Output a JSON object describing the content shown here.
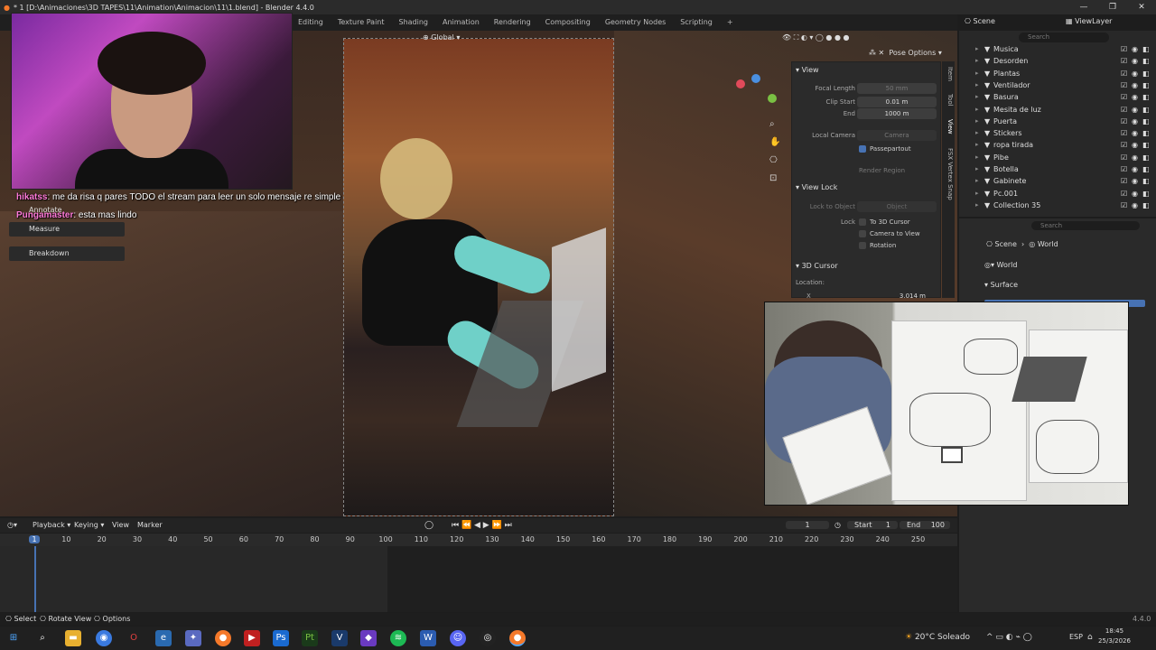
{
  "title_bar": {
    "title": "* 1 [D:\\Animaciones\\3D TAPES\\11\\Animation\\Animacion\\11\\1.blend] - Blender 4.4.0",
    "minimize": "—",
    "maximize": "❐",
    "close": "✕"
  },
  "workspace_tabs": [
    "Editing",
    "Texture Paint",
    "Shading",
    "Animation",
    "Rendering",
    "Compositing",
    "Geometry Nodes",
    "Scripting",
    "+"
  ],
  "viewport_header": {
    "orientation": "Global",
    "pose_options": "Pose Options"
  },
  "chat": [
    {
      "user": "hikatss",
      "message": "me da risa q pares TODO el stream para leer un solo mensaje re simple"
    },
    {
      "user": "Pungamaster",
      "message": "esta mas lindo"
    }
  ],
  "tool_popups": [
    "Annotate",
    "Measure",
    "Breakdown"
  ],
  "npanel": {
    "tabs": [
      "Item",
      "Tool",
      "View",
      "FSX Vertex Snap"
    ],
    "view_header": "View",
    "focal_length_label": "Focal Length",
    "focal_length_value": "50 mm",
    "clip_start_label": "Clip Start",
    "clip_start_value": "0.01 m",
    "end_label": "End",
    "end_value": "1000 m",
    "local_camera_label": "Local Camera",
    "local_camera_value": "Camera",
    "passepartout_label": "Passepartout",
    "render_region_label": "Render Region",
    "view_lock_header": "View Lock",
    "lock_to_object_label": "Lock to Object",
    "lock_to_object_value": "Object",
    "lock_label": "Lock",
    "to_3d_cursor": "To 3D Cursor",
    "camera_to_view": "Camera to View",
    "rotation": "Rotation",
    "cursor_header": "3D Cursor",
    "location_label": "Location:",
    "x_label": "X",
    "x_value": "3.014 m"
  },
  "outliner": {
    "scene": "Scene",
    "view_layer": "ViewLayer",
    "search_placeholder": "Search",
    "items": [
      "Musica",
      "Desorden",
      "Plantas",
      "Ventilador",
      "Basura",
      "Mesita de luz",
      "Puerta",
      "Stickers",
      "ropa tirada",
      "Pibe",
      "Botella",
      "Gabinete",
      "Pc.001",
      "Collection 35"
    ]
  },
  "properties": {
    "breadcrumb_scene": "Scene",
    "breadcrumb_world": "World",
    "world_name": "World",
    "surface": "Surface",
    "search_placeholder": "Search"
  },
  "timeline": {
    "menus": [
      "Playback",
      "Keying",
      "View",
      "Marker"
    ],
    "current_frame": "1",
    "start_label": "Start",
    "start_value": "1",
    "end_label": "End",
    "end_value": "100",
    "ticks": [
      "1",
      "10",
      "20",
      "30",
      "40",
      "50",
      "60",
      "70",
      "80",
      "90",
      "100",
      "110",
      "120",
      "130",
      "140",
      "150",
      "160",
      "170",
      "180",
      "190",
      "200",
      "210",
      "220",
      "230",
      "240",
      "250"
    ]
  },
  "status_bar": {
    "select": "Select",
    "rotate_view": "Rotate View",
    "options": "Options",
    "version": "4.4.0"
  },
  "taskbar": {
    "weather": "20°C Soleado",
    "lang": "ESP",
    "time": "18:45",
    "date": "25/3/2026"
  }
}
